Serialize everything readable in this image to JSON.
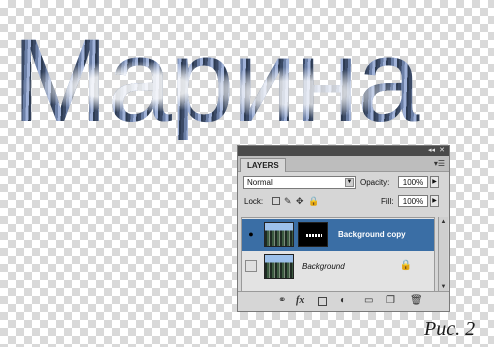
{
  "canvas": {
    "text": "Маринa",
    "caption": "Рис. 2"
  },
  "layers_panel": {
    "window_controls": {
      "collapse": "◂◂",
      "close": "✕"
    },
    "tab_label": "LAYERS",
    "menu_icon": "panel-menu-icon",
    "blend_mode": "Normal",
    "opacity_label": "Opacity:",
    "opacity_value": "100%",
    "lock_label": "Lock:",
    "fill_label": "Fill:",
    "fill_value": "100%",
    "layers": [
      {
        "name": "Background copy",
        "selected": true,
        "visible": true,
        "has_mask": true,
        "locked": false
      },
      {
        "name": "Background",
        "selected": false,
        "visible": false,
        "has_mask": false,
        "locked": true
      }
    ],
    "bottom_icons": [
      "link-layers-icon",
      "fx-icon",
      "add-mask-icon",
      "adjustment-layer-icon",
      "new-group-icon",
      "new-layer-icon",
      "delete-layer-icon"
    ],
    "fx_label": "fx"
  },
  "colors": {
    "selection": "#3a6ea5",
    "panel_bg": "#d6d6d6"
  }
}
